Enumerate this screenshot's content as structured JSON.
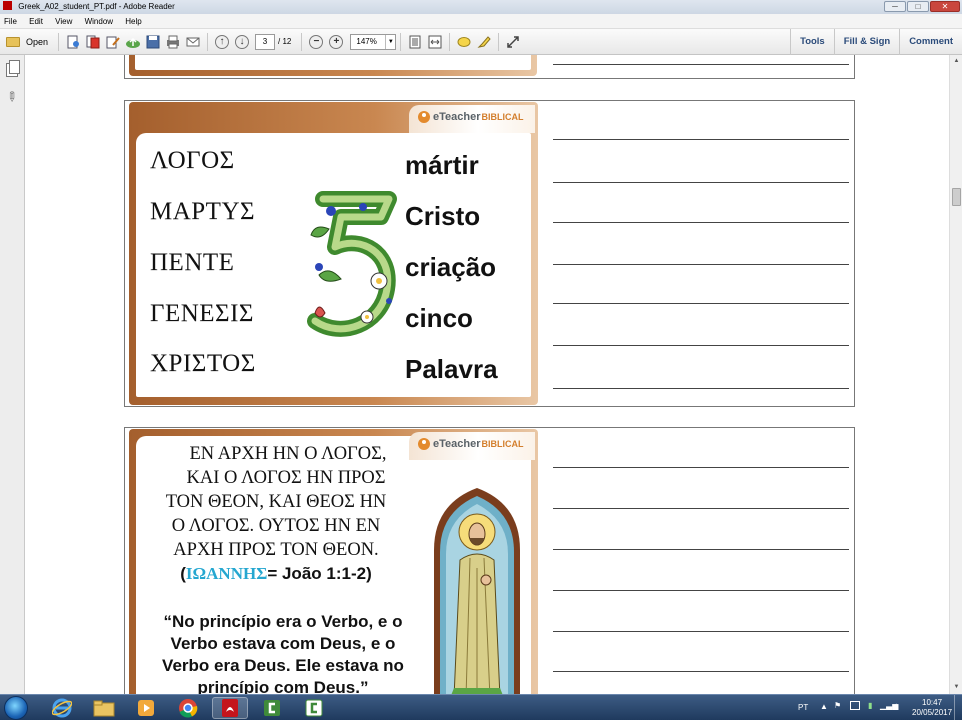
{
  "window": {
    "title": "Greek_A02_student_PT.pdf - Adobe Reader",
    "buttons": {
      "minimize": "─",
      "maximize": "□",
      "close": "✕"
    }
  },
  "menu": [
    "File",
    "Edit",
    "View",
    "Window",
    "Help"
  ],
  "toolbar": {
    "open_label": "Open",
    "page_current": "3",
    "page_total": "/ 12",
    "zoom": "147%",
    "right": {
      "tools": "Tools",
      "fill_sign": "Fill & Sign",
      "comment": "Comment"
    }
  },
  "slide1": {
    "logo": {
      "brand": "eTeacher",
      "suffix": "BIBLICAL"
    },
    "greek_words": [
      "ΛΟΓΟΣ",
      "ΜΑΡΤΥΣ",
      "ΠΕΝΤΕ",
      "ΓΕΝΕΣΙΣ",
      "ΧΡΙΣΤΟΣ"
    ],
    "portuguese_words": [
      "mártir",
      "Cristo",
      "criação",
      "cinco",
      "Palavra"
    ]
  },
  "slide2": {
    "logo": {
      "brand": "eTeacher",
      "suffix": "BIBLICAL"
    },
    "verse_lines": [
      "ΕΝ ΑΡΧΗ ΗΝ Ο ΛΟΓΟΣ,",
      "ΚΑΙ Ο ΛΟΓΟΣ ΗΝ ΠΡΟΣ",
      "ΤΟΝ ΘΕΟΝ, ΚΑΙ ΘΕΟΣ ΗΝ",
      "Ο ΛΟΓΟΣ. ΟΥΤΟΣ ΗΝ ΕΝ",
      "ΑΡΧΗ ΠΡΟΣ ΤΟΝ ΘΕΟΝ."
    ],
    "citation": {
      "open": "(",
      "book_greek": "ΙΩΑΝΝΗΣ",
      "rest": "=  João 1:1-2)"
    },
    "quote_lines": [
      "“No princípio era o Verbo, e o",
      "Verbo estava com Deus, e o",
      "Verbo era Deus. Ele estava no",
      "princípio com Deus.”"
    ]
  },
  "taskbar": {
    "lang": "PT",
    "time": "10:47",
    "date": "20/05/2017"
  },
  "colors": {
    "frame_brown": "#a45f2d",
    "cite_blue": "#25a7d0",
    "logo_orange": "#e38a2d"
  }
}
